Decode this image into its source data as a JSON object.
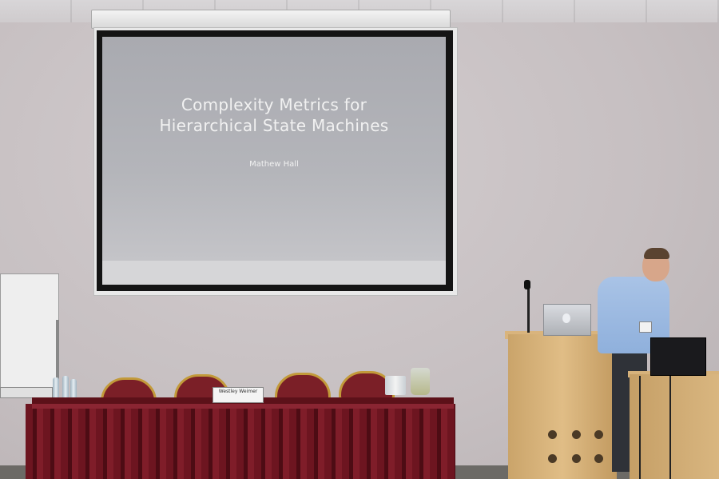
{
  "slide": {
    "title": "Complexity Metrics for\nHierarchical State Machines",
    "author": "Mathew Hall"
  },
  "name_card": {
    "text": "Westley Weimer"
  },
  "colors": {
    "wall": "#c9c4c6",
    "slide_background": "#b0b1b6",
    "tablecloth": "#6d1520",
    "chair_frame": "#c29a3a",
    "podium_wood": "#d8b47d",
    "shirt": "#9fbbe2"
  },
  "icons": {
    "laptop_logo": "apple-logo-icon"
  }
}
